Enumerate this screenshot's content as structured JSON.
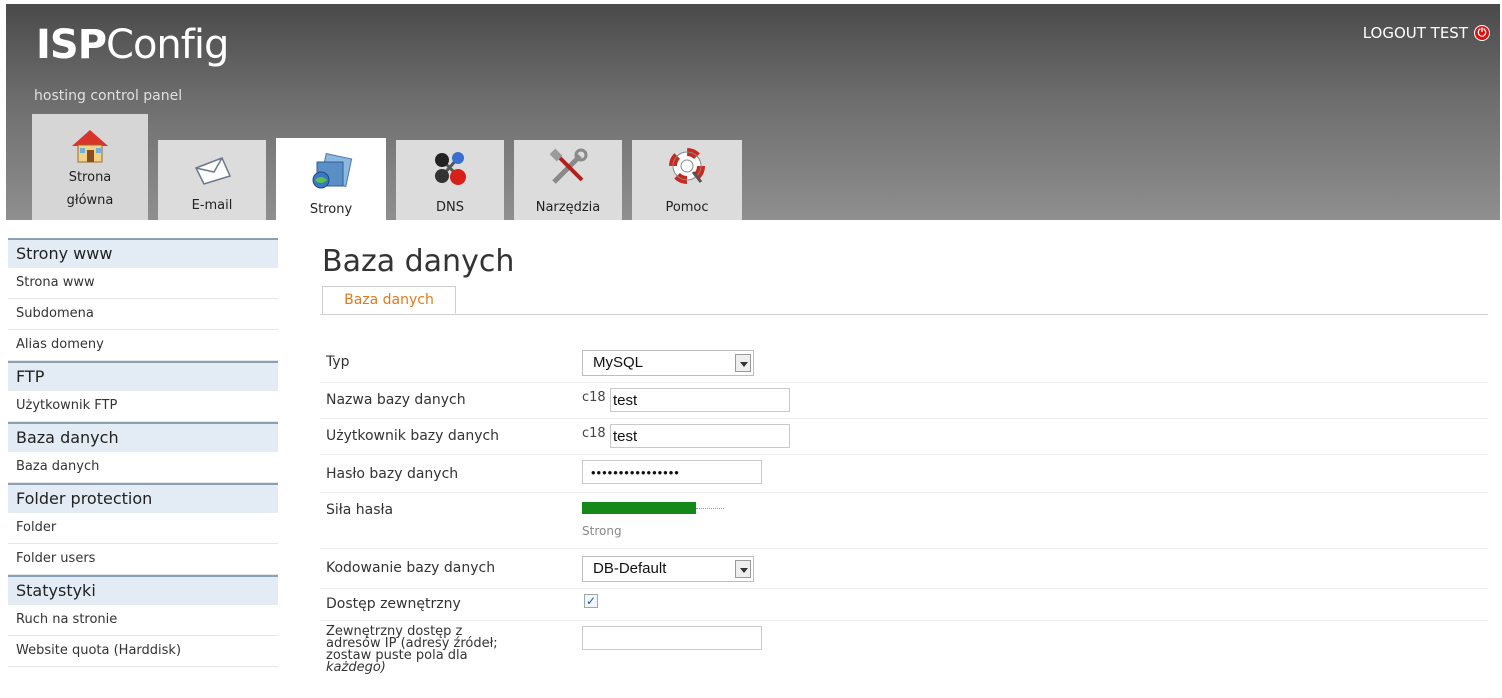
{
  "header": {
    "logo_bold": "ISP",
    "logo_rest": "Config",
    "tagline": "hosting control panel",
    "logout_label": "LOGOUT TEST"
  },
  "tabs": [
    {
      "label_line1": "Strona",
      "label_line2": "główna",
      "icon": "home-icon"
    },
    {
      "label": "E-mail",
      "icon": "envelope-icon"
    },
    {
      "label": "Strony",
      "icon": "globe-folder-icon"
    },
    {
      "label": "DNS",
      "icon": "network-nodes-icon"
    },
    {
      "label": "Narzędzia",
      "icon": "tools-icon"
    },
    {
      "label": "Pomoc",
      "icon": "lifebuoy-icon"
    }
  ],
  "sidebar": {
    "sections": [
      {
        "title": "Strony www",
        "items": [
          "Strona www",
          "Subdomena",
          "Alias domeny"
        ]
      },
      {
        "title": "FTP",
        "items": [
          "Użytkownik FTP"
        ]
      },
      {
        "title": "Baza danych",
        "items": [
          "Baza danych"
        ]
      },
      {
        "title": "Folder protection",
        "items": [
          "Folder",
          "Folder users"
        ]
      },
      {
        "title": "Statystyki",
        "items": [
          "Ruch na stronie",
          "Website quota (Harddisk)"
        ]
      }
    ]
  },
  "main": {
    "page_title": "Baza danych",
    "subtab_label": "Baza danych",
    "form": {
      "typ_label": "Typ",
      "typ_value": "MySQL",
      "db_name_label": "Nazwa bazy danych",
      "db_name_prefix": "c18",
      "db_name_value": "test",
      "db_user_label": "Użytkownik bazy danych",
      "db_user_prefix": "c18",
      "db_user_value": "test",
      "db_password_label": "Hasło bazy danych",
      "db_password_value": "••••••••••••••••",
      "strength_label": "Siła hasła",
      "strength_text": "Strong",
      "strength_fraction": 0.8,
      "charset_label": "Kodowanie bazy danych",
      "charset_value": "DB-Default",
      "remote_access_label": "Dostęp zewnętrzny",
      "remote_access_checked": true,
      "remote_ips_label_line1": "Zewnętrzny dostęp z",
      "remote_ips_label_line2": "adresów IP (adresy źródeł;",
      "remote_ips_label_line3": "zostaw puste pola dla",
      "remote_ips_label_line4": "każdego)",
      "remote_ips_value": ""
    }
  }
}
